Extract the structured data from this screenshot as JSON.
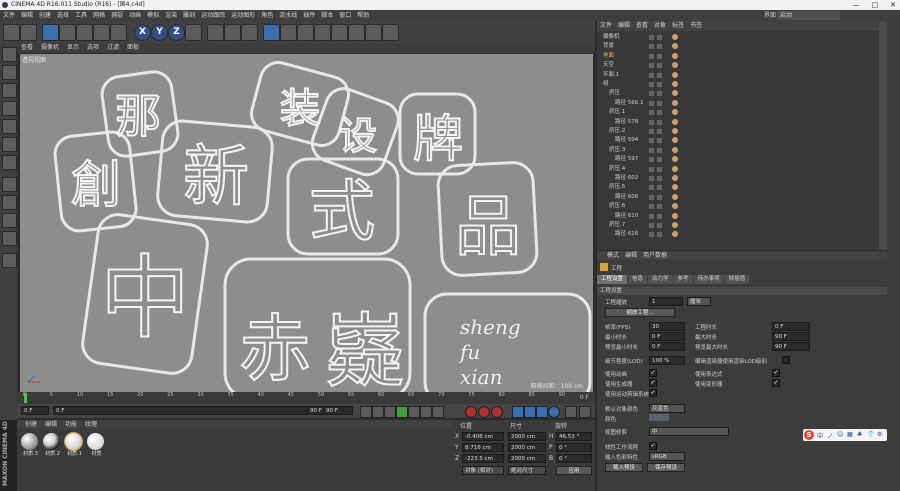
{
  "window": {
    "title": "CINEMA 4D R16.011 Studio (R16) - [国4.c4d]",
    "controls": [
      "—",
      "□",
      "✕"
    ]
  },
  "menubar": {
    "items": [
      "文件",
      "编辑",
      "创建",
      "选择",
      "工具",
      "网格",
      "捕捉",
      "动画",
      "模拟",
      "渲染",
      "雕刻",
      "运动跟踪",
      "运动图形",
      "角色",
      "流水线",
      "插件",
      "脚本",
      "窗口",
      "帮助"
    ],
    "layout_label": "界面",
    "layout_value": "启动"
  },
  "viewport": {
    "menu": [
      "查看",
      "摄像机",
      "显示",
      "选项",
      "过滤",
      "面板"
    ],
    "label": "透视视图",
    "scale": "网格间距：100 cm",
    "glyphs": [
      "那",
      "装",
      "设",
      "牌",
      "創",
      "新",
      "式",
      "品",
      "中",
      "赤",
      "嶷",
      "sheng",
      "fu",
      "xian"
    ]
  },
  "timeline": {
    "ticks": [
      "0",
      "5",
      "10",
      "15",
      "20",
      "25",
      "30",
      "35",
      "40",
      "45",
      "50",
      "55",
      "60",
      "65",
      "70",
      "75",
      "80",
      "85",
      "90"
    ],
    "end": "0 F"
  },
  "playback": {
    "start": "0 F",
    "current": "0 F",
    "end_field": "90 F",
    "end_field2": "90 F"
  },
  "materials": {
    "menu": [
      "创建",
      "编辑",
      "功能",
      "纹理"
    ],
    "items": [
      "材质.3",
      "材质.2",
      "材质.1",
      "材质"
    ]
  },
  "coords": {
    "headers": [
      "位置",
      "尺寸",
      "旋转"
    ],
    "rows": [
      {
        "axis": "X",
        "pos": "-0.406 cm",
        "size": "2000 cm",
        "rot_label": "H",
        "rot": "46.53 °"
      },
      {
        "axis": "Y",
        "pos": "8.716 cm",
        "size": "2000 cm",
        "rot_label": "P",
        "rot": "0 °"
      },
      {
        "axis": "Z",
        "pos": "-223.5 cm",
        "size": "2000 cm",
        "rot_label": "B",
        "rot": "0 °"
      }
    ],
    "mode1": "对象 (相对)",
    "mode2": "绝对尺寸",
    "apply": "应用"
  },
  "objects": {
    "menu": [
      "文件",
      "编辑",
      "查看",
      "对象",
      "标签",
      "书签"
    ],
    "rows": [
      {
        "name": "摄像机",
        "indent": 0,
        "selected": false
      },
      {
        "name": "背景",
        "indent": 0,
        "selected": false
      },
      {
        "name": "地面",
        "indent": 0,
        "selected": true
      },
      {
        "name": "天空",
        "indent": 0,
        "selected": false
      },
      {
        "name": "平面.1",
        "indent": 0,
        "selected": false
      },
      {
        "name": "组",
        "indent": 0,
        "selected": false
      },
      {
        "name": "挤压",
        "indent": 1,
        "selected": false
      },
      {
        "name": "路径 566.1",
        "indent": 2,
        "selected": false
      },
      {
        "name": "挤压.1",
        "indent": 1,
        "selected": false
      },
      {
        "name": "路径 578",
        "indent": 2,
        "selected": false
      },
      {
        "name": "挤压.2",
        "indent": 1,
        "selected": false
      },
      {
        "name": "路径 594",
        "indent": 2,
        "selected": false
      },
      {
        "name": "挤压.3",
        "indent": 1,
        "selected": false
      },
      {
        "name": "路径 597",
        "indent": 2,
        "selected": false
      },
      {
        "name": "挤压.4",
        "indent": 1,
        "selected": false
      },
      {
        "name": "路径 602",
        "indent": 2,
        "selected": false
      },
      {
        "name": "挤压.5",
        "indent": 1,
        "selected": false
      },
      {
        "name": "路径 606",
        "indent": 2,
        "selected": false
      },
      {
        "name": "挤压.6",
        "indent": 1,
        "selected": false
      },
      {
        "name": "路径 610",
        "indent": 2,
        "selected": false
      },
      {
        "name": "挤压.7",
        "indent": 1,
        "selected": false
      },
      {
        "name": "路径 616",
        "indent": 2,
        "selected": false
      }
    ]
  },
  "attributes": {
    "menu": [
      "模式",
      "编辑",
      "用户数据"
    ],
    "object_label": "工程",
    "tabs": [
      "工程设置",
      "信息",
      "动力学",
      "参考",
      "待办事项",
      "帧插值"
    ],
    "section": "工程设置",
    "scale_label": "工程缩放",
    "scale_value": "1",
    "scale_unit": "厘米",
    "scale_button": "缩放工程...",
    "left_fields": [
      {
        "label": "帧率(FPS)",
        "value": "30"
      },
      {
        "label": "最小时长",
        "value": "0 F"
      },
      {
        "label": "预览最小时长",
        "value": "0 F"
      },
      {
        "label": "细节程度(LOD)",
        "value": "100 %"
      }
    ],
    "right_fields": [
      {
        "label": "工程时长",
        "value": "0 F"
      },
      {
        "label": "最大时长",
        "value": "90 F"
      },
      {
        "label": "预览最大时长",
        "value": "90 F"
      },
      {
        "label": "编辑渲染器使用渲染LOD级别",
        "value": ""
      }
    ],
    "checks_left": [
      "使用动画",
      "使用生成器",
      "使用运动剪辑系统"
    ],
    "checks_right": [
      "使用表达式",
      "使用变形器"
    ],
    "default_color_label": "默认对象颜色",
    "default_color_value": "灰蓝色",
    "color_label": "颜色",
    "view_clip_label": "视图修剪",
    "view_clip_value": "中",
    "linear_label": "线性工作流程",
    "input_color_label": "输入色彩特性",
    "input_color_value": "sRGB",
    "load_preset": "载入预设",
    "save_preset": "保存预设"
  },
  "ime": {
    "glyphs": [
      "中",
      "ノ",
      "☺",
      "▦",
      "♣",
      "👕",
      "⚙"
    ]
  },
  "colors": {
    "selected": "#f0b04a",
    "accent_blue": "#3a6fb0",
    "viewport_bg": "#8b8b8b"
  }
}
